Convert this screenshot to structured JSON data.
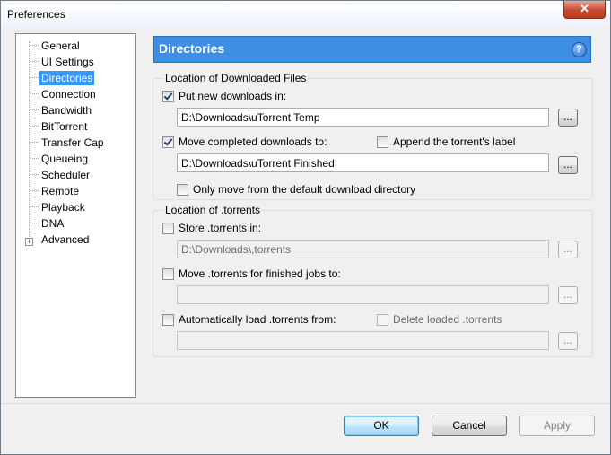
{
  "window": {
    "title": "Preferences",
    "close_label": "✕"
  },
  "sidebar": {
    "items": [
      {
        "label": "General"
      },
      {
        "label": "UI Settings"
      },
      {
        "label": "Directories"
      },
      {
        "label": "Connection"
      },
      {
        "label": "Bandwidth"
      },
      {
        "label": "BitTorrent"
      },
      {
        "label": "Transfer Cap"
      },
      {
        "label": "Queueing"
      },
      {
        "label": "Scheduler"
      },
      {
        "label": "Remote"
      },
      {
        "label": "Playback"
      },
      {
        "label": "DNA"
      },
      {
        "label": "Advanced"
      }
    ],
    "selected": "Directories",
    "expander_glyph": "+"
  },
  "panel": {
    "title": "Directories",
    "help_glyph": "?"
  },
  "downloaded": {
    "group_label": "Location of Downloaded Files",
    "put_new_label": "Put new downloads in:",
    "put_new_checked": true,
    "put_new_path": "D:\\Downloads\\uTorrent Temp",
    "move_completed_label": "Move completed downloads to:",
    "move_completed_checked": true,
    "append_label": "Append the torrent's label",
    "append_checked": false,
    "move_completed_path": "D:\\Downloads\\uTorrent Finished",
    "only_move_label": "Only move from the default download directory",
    "only_move_checked": false
  },
  "torrents": {
    "group_label": "Location of .torrents",
    "store_label": "Store .torrents in:",
    "store_checked": false,
    "store_path": "D:\\Downloads\\,torrents",
    "move_finished_label": "Move .torrents for finished jobs to:",
    "move_finished_checked": false,
    "move_finished_path": "",
    "autoload_label": "Automatically load .torrents from:",
    "autoload_checked": false,
    "delete_loaded_label": "Delete loaded .torrents",
    "delete_loaded_checked": false,
    "autoload_path": ""
  },
  "browse_label": "...",
  "buttons": {
    "ok": "OK",
    "cancel": "Cancel",
    "apply": "Apply"
  }
}
